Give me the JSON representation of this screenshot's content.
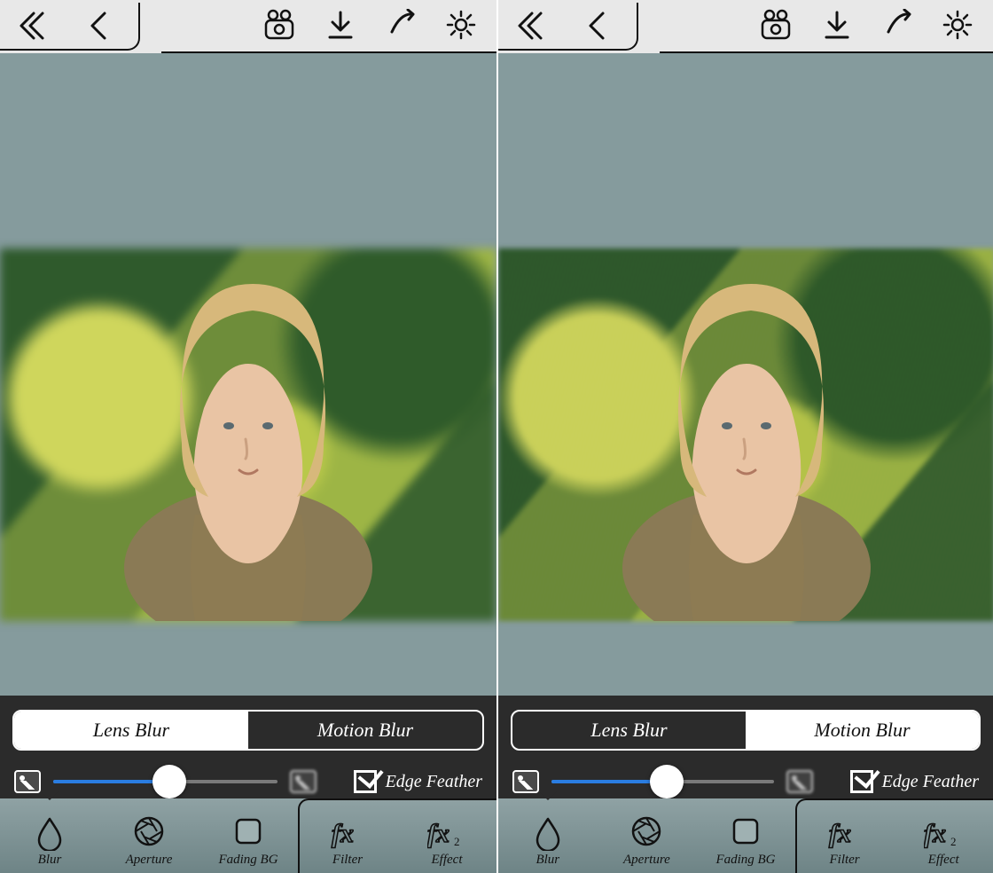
{
  "top_icons": {
    "back_all": "back-all-icon",
    "back": "back-icon",
    "video": "camera-icon",
    "download": "download-icon",
    "share": "share-icon",
    "settings": "gear-icon"
  },
  "segmented": {
    "lens": "Lens Blur",
    "motion": "Motion Blur"
  },
  "edge_feather_label": "Edge Feather",
  "tabs": [
    {
      "key": "blur",
      "label": "Blur"
    },
    {
      "key": "aperture",
      "label": "Aperture"
    },
    {
      "key": "fadingbg",
      "label": "Fading BG"
    },
    {
      "key": "filter",
      "label": "Filter"
    },
    {
      "key": "effect",
      "label": "Effect"
    }
  ],
  "panes": [
    {
      "active_segment": "lens",
      "slider_pct": 52,
      "edge_checked": true,
      "active_tab": "blur"
    },
    {
      "active_segment": "motion",
      "slider_pct": 52,
      "edge_checked": true,
      "active_tab": "blur"
    }
  ]
}
